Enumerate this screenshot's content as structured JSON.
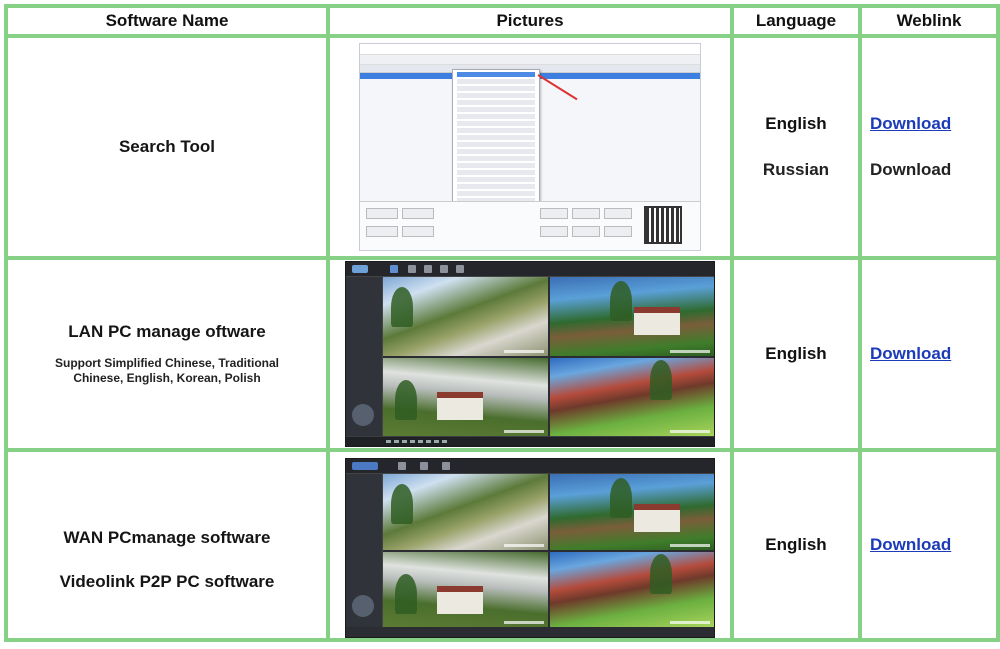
{
  "table": {
    "headers": {
      "name": "Software Name",
      "pictures": "Pictures",
      "language": "Language",
      "weblink": "Weblink"
    },
    "rows": [
      {
        "name": "Search Tool",
        "languages": [
          "English",
          "Russian"
        ],
        "links": [
          {
            "label": "Download",
            "style": "hyperlink"
          },
          {
            "label": "Download",
            "style": "plain"
          }
        ],
        "picture_icon": "search-tool-screenshot"
      },
      {
        "name": "LAN PC manage oftware",
        "subtitle_line1": "Support Simplified Chinese, Traditional",
        "subtitle_line2": "Chinese, English, Korean, Polish",
        "languages": [
          "English"
        ],
        "links": [
          {
            "label": "Download",
            "style": "hyperlink"
          }
        ],
        "picture_icon": "lan-camera-client-screenshot"
      },
      {
        "name": "WAN PCmanage software",
        "name2": "Videolink P2P PC software",
        "languages": [
          "English"
        ],
        "links": [
          {
            "label": "Download",
            "style": "hyperlink"
          }
        ],
        "picture_icon": "wan-camera-client-screenshot"
      }
    ]
  },
  "colors": {
    "border": "#86d186",
    "link": "#1c3bb8",
    "text": "#111111"
  }
}
